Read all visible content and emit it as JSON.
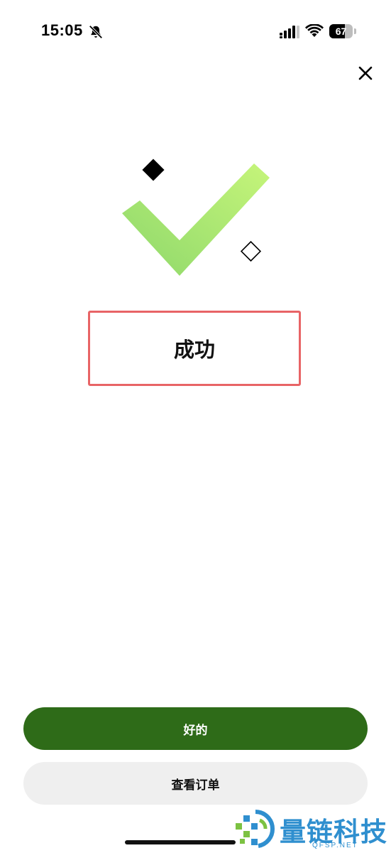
{
  "status_bar": {
    "time": "15:05",
    "battery_percent": "67",
    "battery_level": 0.67
  },
  "close": {
    "icon": "close-icon"
  },
  "result": {
    "title": "成功",
    "check_gradient_start": "#8ed86b",
    "check_gradient_end": "#c6f57a"
  },
  "actions": {
    "primary_label": "好的",
    "secondary_label": "查看订单",
    "primary_color": "#2e6b18",
    "secondary_color": "#efefef"
  },
  "watermark": {
    "name": "量链科技",
    "url": "QFSP.NET",
    "color": "#2f8fcf"
  }
}
